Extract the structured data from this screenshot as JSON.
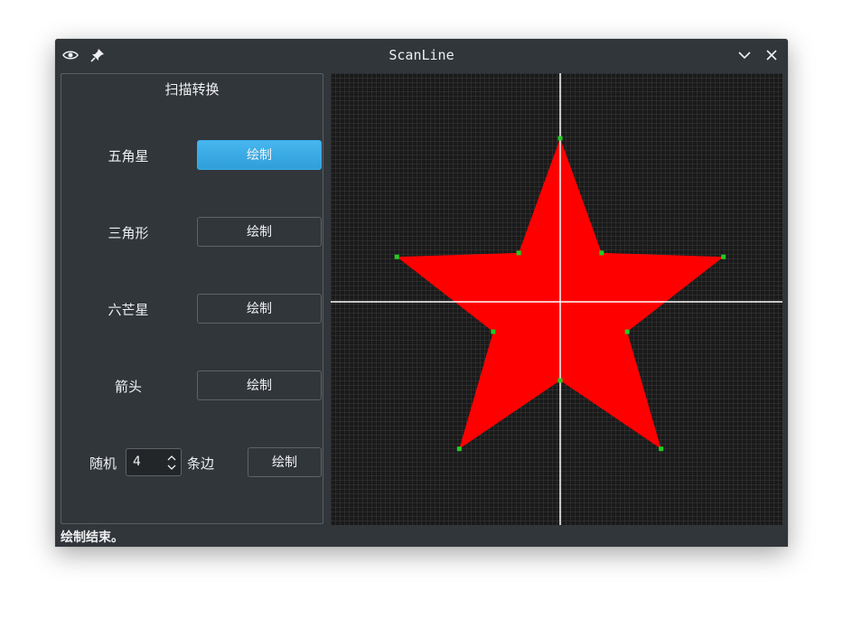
{
  "window": {
    "title": "ScanLine",
    "icons": {
      "left": [
        "eye-icon",
        "pin-icon"
      ],
      "right": [
        "chevron-down-icon",
        "close-icon"
      ]
    },
    "colors": {
      "background": "#31363b",
      "text": "#eff0f1",
      "accent": "#3daee9"
    }
  },
  "panel": {
    "title": "扫描转换",
    "rows": [
      {
        "label": "五角星",
        "button": "绘制",
        "active": true
      },
      {
        "label": "三角形",
        "button": "绘制",
        "active": false
      },
      {
        "label": "六芒星",
        "button": "绘制",
        "active": false
      },
      {
        "label": "箭头",
        "button": "绘制",
        "active": false
      }
    ],
    "random": {
      "prefix": "随机",
      "value": "4",
      "suffix": "条边",
      "button": "绘制"
    }
  },
  "canvas": {
    "grid_cells": 100,
    "fill_color": "#ff0000",
    "vertex_color": "#22cc22",
    "axis_color": "#ffffff",
    "grid_color": "#3b3b3b",
    "shape": "五角星"
  },
  "status": {
    "text": "绘制结束。"
  }
}
